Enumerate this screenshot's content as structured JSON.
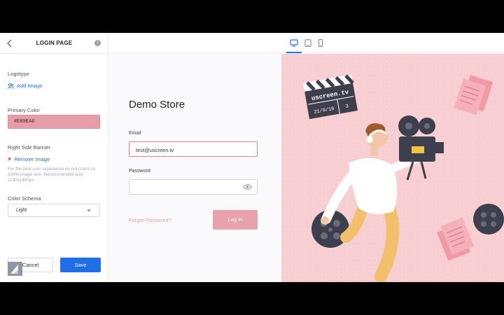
{
  "sidebar": {
    "title": "LOGIN PAGE",
    "logotype_label": "Logotype",
    "add_image": "Add Image",
    "primary_color_label": "Primary Color",
    "primary_color_value": "#E89EA6",
    "right_banner_label": "Right Side Banner",
    "remove_image": "Remove Image",
    "hint": "For the best user experience do not count on 100% image size. Recommended size: 1130x1400px",
    "color_schema_label": "Color Schema",
    "color_schema_value": "Light",
    "cancel_label": "Cancel",
    "save_label": "Save"
  },
  "preview": {
    "store_title": "Demo Store",
    "email_label": "Email",
    "email_value": "test@uscreen.tv",
    "password_label": "Password",
    "password_value": "",
    "forgot_password": "Forgot Password?",
    "login_button": "Log in"
  },
  "banner": {
    "clapper_title": "uscreen.tv",
    "clapper_date": "21/9/18",
    "clapper_take": "3"
  },
  "colors": {
    "accent": "#1F6FE8",
    "brand_pink": "#E89EA6",
    "banner_bg": "#F8CFD3"
  },
  "devices": [
    "desktop-icon",
    "tablet-icon",
    "mobile-icon"
  ]
}
